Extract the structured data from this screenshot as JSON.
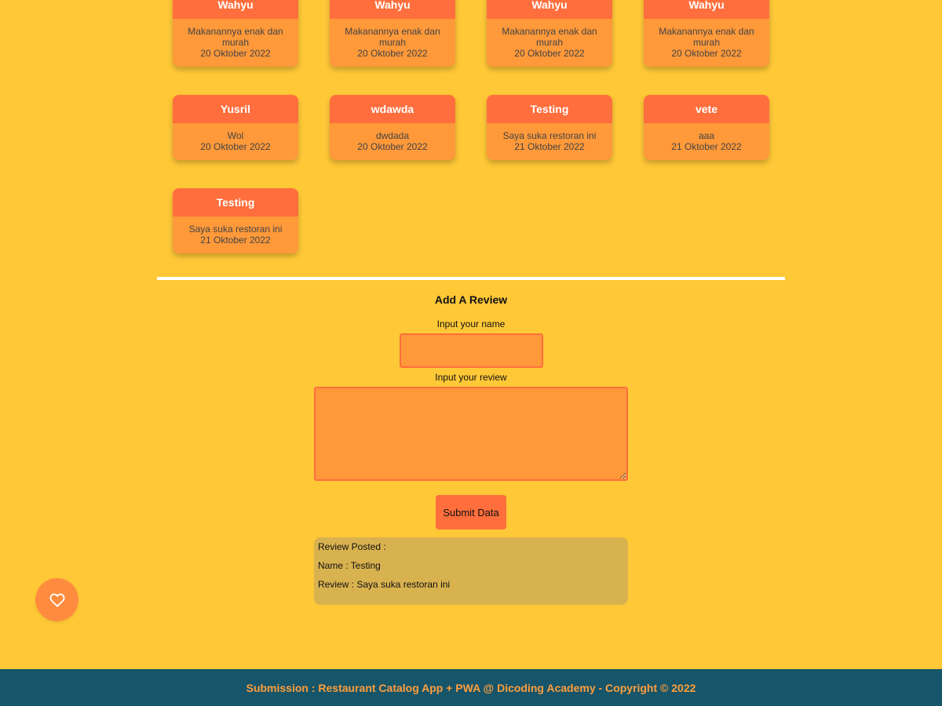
{
  "reviews": [
    {
      "name": "Wahyu",
      "review": "Makanannya enak dan murah",
      "date": "20 Oktober 2022"
    },
    {
      "name": "Wahyu",
      "review": "Makanannya enak dan murah",
      "date": "20 Oktober 2022"
    },
    {
      "name": "Wahyu",
      "review": "Makanannya enak dan murah",
      "date": "20 Oktober 2022"
    },
    {
      "name": "Wahyu",
      "review": "Makanannya enak dan murah",
      "date": "20 Oktober 2022"
    },
    {
      "name": "Yusril",
      "review": "Wol",
      "date": "20 Oktober 2022"
    },
    {
      "name": "wdawda",
      "review": "dwdada",
      "date": "20 Oktober 2022"
    },
    {
      "name": "Testing",
      "review": "Saya suka restoran ini",
      "date": "21 Oktober 2022"
    },
    {
      "name": "vete",
      "review": "aaa",
      "date": "21 Oktober 2022"
    },
    {
      "name": "Testing",
      "review": "Saya suka restoran ini",
      "date": "21 Oktober 2022"
    }
  ],
  "form": {
    "title": "Add A Review",
    "name_label": "Input your name",
    "name_value": "",
    "review_label": "Input your review",
    "review_value": "",
    "submit_label": "Submit Data"
  },
  "posted": {
    "heading": "Review Posted :",
    "name_line": "Name : Testing",
    "review_line": "Review : Saya suka restoran ini"
  },
  "favorite": {
    "icon": "heart-outline-icon"
  },
  "footer": {
    "text": "Submission : Restaurant Catalog App + PWA @ Dicoding Academy - Copyright © 2022"
  },
  "colors": {
    "background": "#ffc837",
    "card_header": "#ff6e3c",
    "card_body": "#ff993a",
    "posted_box": "#d9b250",
    "footer_bg": "#17556a",
    "footer_text": "#ff9e3b"
  }
}
